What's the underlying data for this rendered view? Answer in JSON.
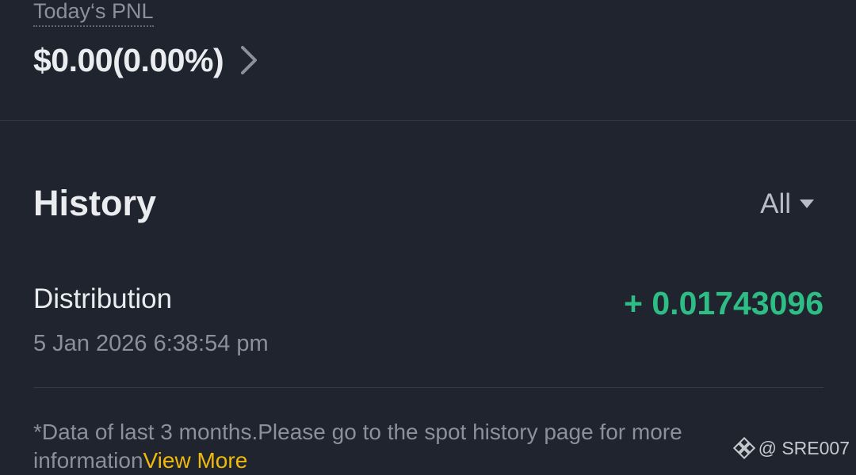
{
  "pnl": {
    "label": "Today‘s PNL",
    "value": "$0.00(0.00%)",
    "chevron_icon": "chevron-right-icon"
  },
  "history": {
    "title": "History",
    "filter": {
      "selected": "All",
      "icon": "caret-down-icon"
    },
    "items": [
      {
        "title": "Distribution",
        "date": "5 Jan 2026 6:38:54 pm",
        "amount": "+ 0.01743096"
      }
    ]
  },
  "footer": {
    "note": "*Data of last 3 months.Please go to the spot history page for more information",
    "view_more": "View More"
  },
  "watermark": {
    "text": "@ SRE007",
    "logo_icon": "binance-logo-icon"
  },
  "colors": {
    "background": "#1f242e",
    "positive": "#2ebd85",
    "accent": "#f0b90b",
    "secondary_text": "#8b919b"
  }
}
